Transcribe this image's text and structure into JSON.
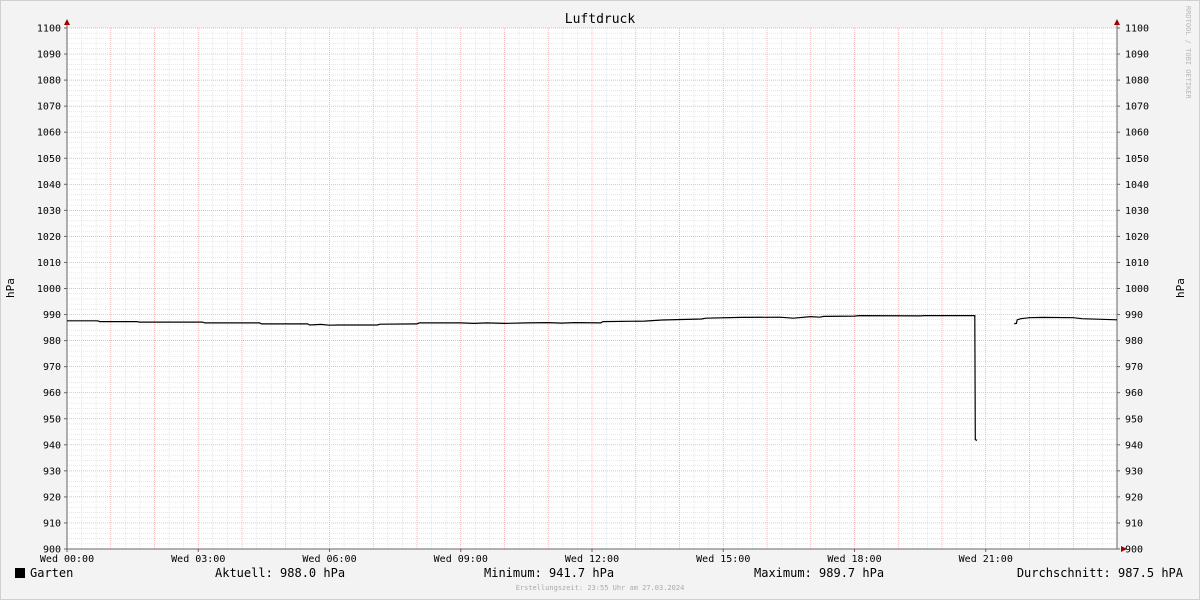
{
  "chart_data": {
    "type": "line",
    "title": "Luftdruck",
    "ylabel": "hPa",
    "ylim": [
      900,
      1100
    ],
    "yticks": [
      "900",
      "910",
      "920",
      "930",
      "940",
      "950",
      "960",
      "970",
      "980",
      "990",
      "1000",
      "1010",
      "1020",
      "1030",
      "1040",
      "1050",
      "1060",
      "1070",
      "1080",
      "1090",
      "1100"
    ],
    "xticks": [
      {
        "t": 0,
        "label": "Wed 00:00"
      },
      {
        "t": 3,
        "label": "Wed 03:00"
      },
      {
        "t": 6,
        "label": "Wed 06:00"
      },
      {
        "t": 9,
        "label": "Wed 09:00"
      },
      {
        "t": 12,
        "label": "Wed 12:00"
      },
      {
        "t": 15,
        "label": "Wed 15:00"
      },
      {
        "t": 18,
        "label": "Wed 18:00"
      },
      {
        "t": 21,
        "label": "Wed 21:00"
      }
    ],
    "xlim": [
      0,
      24
    ],
    "series": [
      {
        "name": "Garten",
        "color": "#000000",
        "segments": [
          [
            [
              0,
              987.6
            ],
            [
              0.7,
              987.6
            ],
            [
              0.75,
              987.3
            ],
            [
              1.6,
              987.3
            ],
            [
              1.65,
              987.1
            ],
            [
              3.1,
              987.1
            ],
            [
              3.15,
              986.8
            ],
            [
              4.4,
              986.8
            ],
            [
              4.45,
              986.4
            ],
            [
              5.5,
              986.4
            ],
            [
              5.55,
              986.0
            ],
            [
              5.8,
              986.2
            ],
            [
              6.0,
              985.9
            ],
            [
              6.2,
              986.0
            ],
            [
              7.1,
              986.0
            ],
            [
              7.15,
              986.3
            ],
            [
              8.0,
              986.4
            ],
            [
              8.05,
              986.8
            ],
            [
              9.0,
              986.8
            ],
            [
              9.3,
              986.6
            ],
            [
              9.6,
              986.8
            ],
            [
              10.0,
              986.6
            ],
            [
              10.5,
              986.8
            ],
            [
              11.0,
              986.9
            ],
            [
              11.3,
              986.7
            ],
            [
              11.6,
              986.9
            ],
            [
              12.2,
              986.8
            ],
            [
              12.25,
              987.3
            ],
            [
              13.2,
              987.5
            ],
            [
              13.6,
              987.9
            ],
            [
              14.5,
              988.3
            ],
            [
              14.6,
              988.6
            ],
            [
              15.4,
              988.9
            ],
            [
              16.3,
              989.0
            ],
            [
              16.6,
              988.6
            ],
            [
              17.0,
              989.2
            ],
            [
              17.2,
              989.0
            ],
            [
              17.3,
              989.3
            ],
            [
              18.0,
              989.4
            ],
            [
              18.1,
              989.6
            ],
            [
              19.5,
              989.5
            ],
            [
              19.6,
              989.6
            ],
            [
              20.75,
              989.6
            ],
            [
              20.76,
              942.0
            ],
            [
              20.8,
              941.7
            ]
          ],
          [
            [
              21.65,
              986.5
            ],
            [
              21.7,
              986.6
            ],
            [
              21.72,
              988.0
            ],
            [
              21.8,
              988.4
            ],
            [
              22.0,
              988.8
            ],
            [
              22.3,
              988.9
            ],
            [
              23.0,
              988.8
            ],
            [
              23.2,
              988.4
            ],
            [
              24.0,
              988.0
            ]
          ]
        ]
      }
    ],
    "legend": {
      "label": "Garten",
      "current": "Aktuell: 988.0 hPa",
      "minimum": "Minimum: 941.7 hPa",
      "maximum": "Maximum: 989.7 hPa",
      "average": "Durchschnitt: 987.5 hPA"
    }
  },
  "footer": "Erstellungszeit: 23:55 Uhr am 27.03.2024",
  "watermark": "RRDTOOL / TOBI OETIKER"
}
